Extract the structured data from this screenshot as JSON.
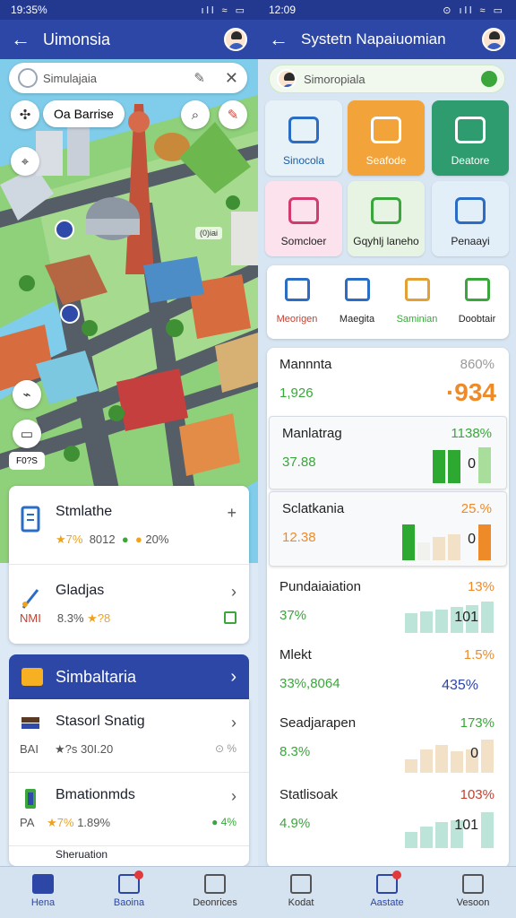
{
  "left": {
    "status": {
      "time": "19:35%",
      "icons": "ıll ≈ ▭"
    },
    "app_bar": {
      "title": "Uimonsia"
    },
    "search": {
      "placeholder": "Simulajaia"
    },
    "map": {
      "chip_label": "Oa Barrise",
      "code_label": "F0?S",
      "tag_label": "(0)iai"
    },
    "cards": [
      {
        "title": "Stmlathe",
        "stars": "★7%",
        "value": "8012",
        "extra": "20%",
        "chevron": "+"
      },
      {
        "title": "Gladjas",
        "code": "NMI",
        "pct": "8.3%",
        "stars": "★?8",
        "chevron": "›"
      }
    ],
    "section_header": {
      "title": "Simbaltaria"
    },
    "list": [
      {
        "title": "Stasorl Snatig",
        "code": "BAI",
        "stars": "★?s",
        "value": "30I.20",
        "extra": "⊙ %"
      },
      {
        "title": "Bmationmds",
        "code": "PA",
        "stars": "★7%",
        "value": "1.89%",
        "extra": "4%"
      },
      {
        "title": "Sheruation"
      }
    ]
  },
  "right": {
    "status": {
      "time": "12:09",
      "icons": "⊙ ıll ≈ ▭"
    },
    "app_bar": {
      "title": "Systetn Napaiuomian"
    },
    "search": {
      "placeholder": "Simoropiala"
    },
    "tiles": [
      {
        "label": "Sinocola",
        "bg": "#e6f1f8",
        "color": "#1a5ea6"
      },
      {
        "label": "Seafode",
        "bg": "#f2a33a",
        "color": "#ffffff"
      },
      {
        "label": "Deatore",
        "bg": "#2e9c6e",
        "color": "#ffffff"
      },
      {
        "label": "Somcloer",
        "bg": "#fbe2ec",
        "color": "#222222"
      },
      {
        "label": "Gqyhlj laneho",
        "bg": "#e7f4e3",
        "color": "#222222"
      },
      {
        "label": "Penaayi",
        "bg": "#e2eef8",
        "color": "#222222"
      }
    ],
    "categories": [
      {
        "label": "Meorigen",
        "color": "#c4402f"
      },
      {
        "label": "Maegita",
        "color": "#222222"
      },
      {
        "label": "Saminian",
        "color": "#3aa63b"
      },
      {
        "label": "Doobtair",
        "color": "#222222"
      }
    ],
    "stats": [
      {
        "title": "Mannnta",
        "pct": "860%",
        "value": "1,926",
        "big": "·934"
      },
      {
        "title": "Manlatrag",
        "pct": "1138%",
        "value": "37.88",
        "num": "0",
        "bars": [
          0.85,
          0.85,
          0.0,
          0.9
        ],
        "colors": [
          "#2da831",
          "#2da831",
          "#ffffff",
          "#a9dd9c"
        ]
      },
      {
        "title": "Sclatkania",
        "pct": "25.%",
        "value": "12.38",
        "num": "0",
        "bars": [
          0.9,
          0.45,
          0.6,
          0.65,
          0.0,
          0.9
        ],
        "colors": [
          "#2da831",
          "#f1f1ee",
          "#f3e1c7",
          "#f3e1c7",
          "#ffffff",
          "#ef8a28"
        ]
      },
      {
        "title": "Pundaiaiation",
        "pct": "13%",
        "value": "37%",
        "num": "101",
        "bars": [
          0.5,
          0.55,
          0.6,
          0.65,
          0.7,
          0.8
        ],
        "colors": [
          "#bde4d9",
          "#bde4d9",
          "#bde4d9",
          "#bde4d9",
          "#bde4d9",
          "#bde4d9"
        ]
      },
      {
        "title": "Mlekt",
        "pct": "1.5%",
        "value": "33%,8064",
        "num": "435%"
      },
      {
        "title": "Seadjarapen",
        "pct": "173%",
        "value": "8.3%",
        "num": "0",
        "bars": [
          0.35,
          0.6,
          0.7,
          0.55,
          0.6,
          0.85
        ],
        "colors": [
          "#f3e1c7",
          "#f3e1c7",
          "#f3e1c7",
          "#f3e1c7",
          "#f3e1c7",
          "#f3e1c7"
        ]
      },
      {
        "title": "Statlisoak",
        "pct": "103%",
        "value": "4.9%",
        "num": "101",
        "bars": [
          0.4,
          0.55,
          0.65,
          0.7,
          0.0,
          0.9
        ],
        "colors": [
          "#bde4d9",
          "#bde4d9",
          "#bde4d9",
          "#bde4d9",
          "#ffffff",
          "#bde4d9"
        ]
      }
    ]
  },
  "nav": [
    {
      "label": "Hena",
      "active": true
    },
    {
      "label": "Baoina",
      "active": true,
      "badge": true
    },
    {
      "label": "Deonrices",
      "active": false
    },
    {
      "label": "Kodat",
      "active": false
    },
    {
      "label": "Aastate",
      "active": true,
      "badge": true
    },
    {
      "label": "Vesoon",
      "active": false
    }
  ]
}
